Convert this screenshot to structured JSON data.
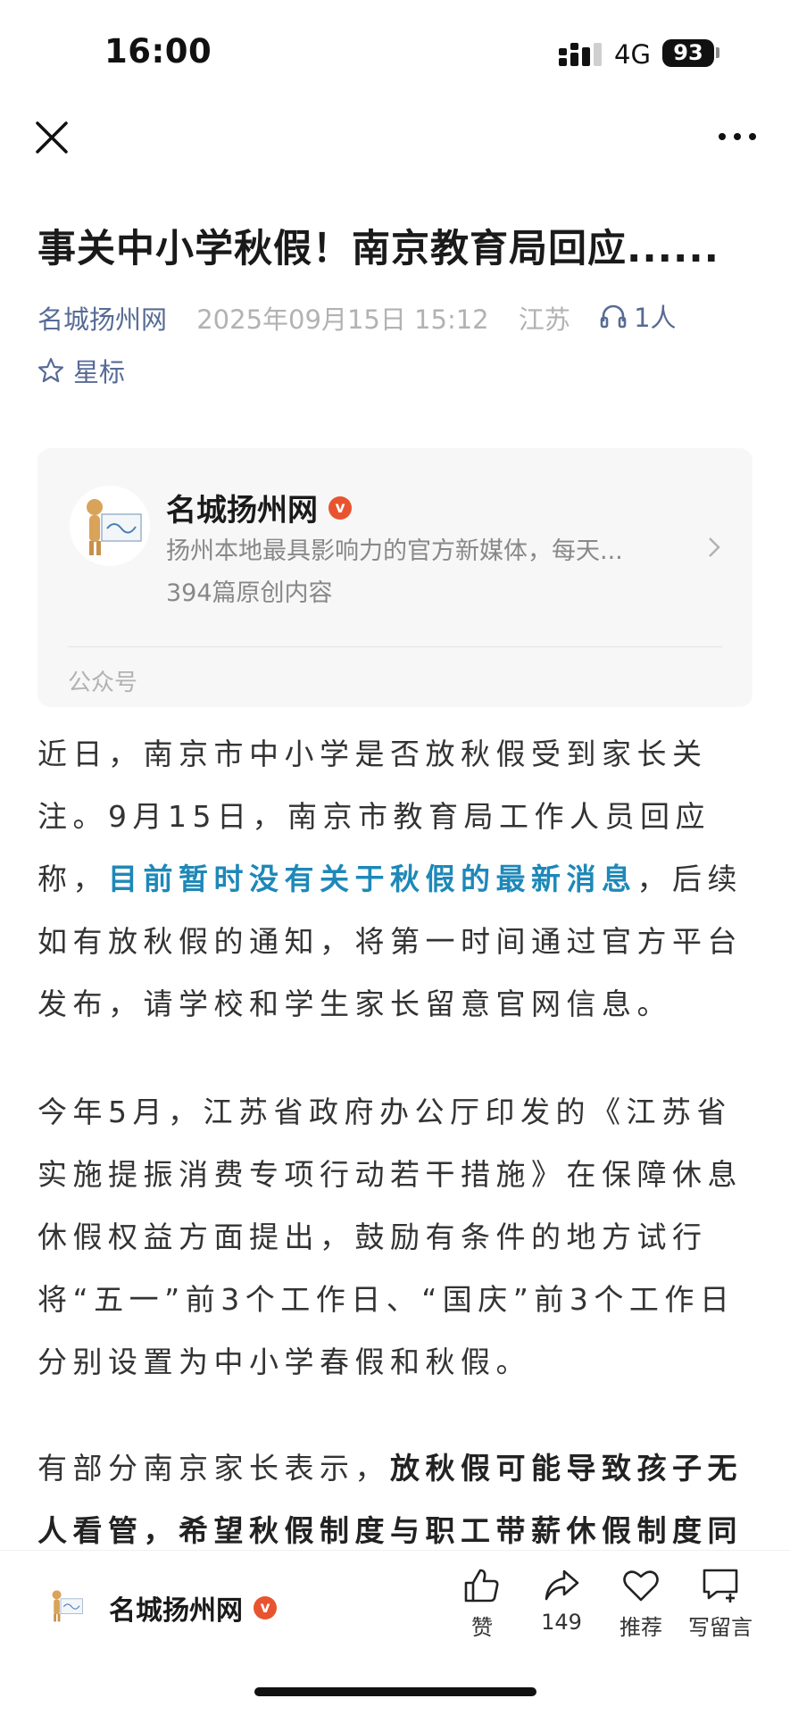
{
  "status_bar": {
    "time": "16:00",
    "network": "4G",
    "battery": "93"
  },
  "article": {
    "title": "事关中小学秋假！南京教育局回应......",
    "source": "名城扬州网",
    "datetime": "2025年09月15日 15:12",
    "location": "江苏",
    "listeners": "1人",
    "star_label": "星标"
  },
  "account_card": {
    "name": "名城扬州网",
    "verified_mark": "v",
    "description": "扬州本地最具影响力的官方新媒体，每天...",
    "original_count": "394篇原创内容",
    "type": "公众号"
  },
  "body": {
    "p1_a": "近日，南京市中小学是否放秋假受到家长关注。9月15日，南京市教育局工作人员回应称，",
    "p1_highlight": "目前暂时没有关于秋假的最新消息",
    "p1_b": "，后续如有放秋假的通知，将第一时间通过官方平台发布，请学校和学生家长留意官网信息。",
    "p2": "今年5月，江苏省政府办公厅印发的《江苏省实施提振消费专项行动若干措施》在保障休息休假权益方面提出，鼓励有条件的地方试行将“五一”前3个工作日、“国庆”前3个工作日分别设置为中小学春假和秋假。",
    "p3_a": "有部分南京家长表示，",
    "p3_bold": "放秋假可能导致孩子无人看管，希望秋假制度与职工带薪休假制度同"
  },
  "bottom_bar": {
    "account_name": "名城扬州网",
    "like_label": "赞",
    "share_count": "149",
    "recommend_label": "推荐",
    "comment_label": "写留言"
  },
  "colors": {
    "link": "#576b95",
    "highlight": "#1e88b8",
    "verified": "#e8542f"
  }
}
